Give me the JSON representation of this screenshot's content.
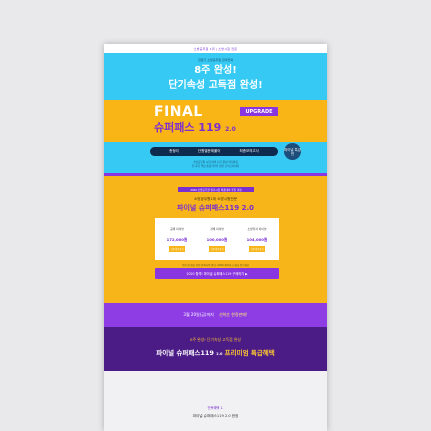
{
  "top": {
    "text": "소방공무원 1위 | 소방시험 전문"
  },
  "hero": {
    "small": "전문가 소방공무원 합격전략",
    "line1": "8주 완성!",
    "line2": "단기속성 고득점 완성!",
    "upgrade": "UPGRADE",
    "final": "FINAL",
    "pass": "슈퍼패스 119",
    "version": "2.0",
    "pill": [
      "총정리",
      "단원별문제풀이",
      "최종모의고사"
    ],
    "badge": "파이널 특강반",
    "note1": "소방공무원 시험 대비 단기 완성 커리큘럼",
    "note2": "전 과목 핵심 총정리부터 실전 모의고사까지"
  },
  "offer": {
    "tag": "2020 소방공무원 필기시험 최종대비 추천 과정",
    "sub": "소방공무원1위 소방시험전문",
    "title": "파이널 슈퍼패스119 2.0",
    "prices": [
      {
        "label": "공채 파이널",
        "value": "172,000원",
        "tag": "신청 바로가기"
      },
      {
        "label": "경채 파이널",
        "value": "100,000원",
        "tag": "신청 바로가기"
      },
      {
        "label": "소방학과 파이널",
        "value": "104,000원",
        "tag": "신청 바로가기"
      }
    ],
    "note": "학습 및 환급 관련 유의사항 안내, 2020 합격하고 환급 받으세요",
    "buy": "2020 합격! 파이널 슈퍼패스119 구매하기 ▶"
  },
  "banner": {
    "text": "3월 20일(금)까지",
    "highlight": "선착순 한정판매!"
  },
  "premium": {
    "sub": "8주 완성! 단기속성 고득점 완성",
    "title_pre": "파이널 슈퍼패스119",
    "title_ver": "2.0",
    "title_post": "프리미엄 특급혜택"
  },
  "benefit": {
    "label": "단독혜택 1.",
    "title": "파이널 슈퍼패스119 2.0 한정"
  }
}
